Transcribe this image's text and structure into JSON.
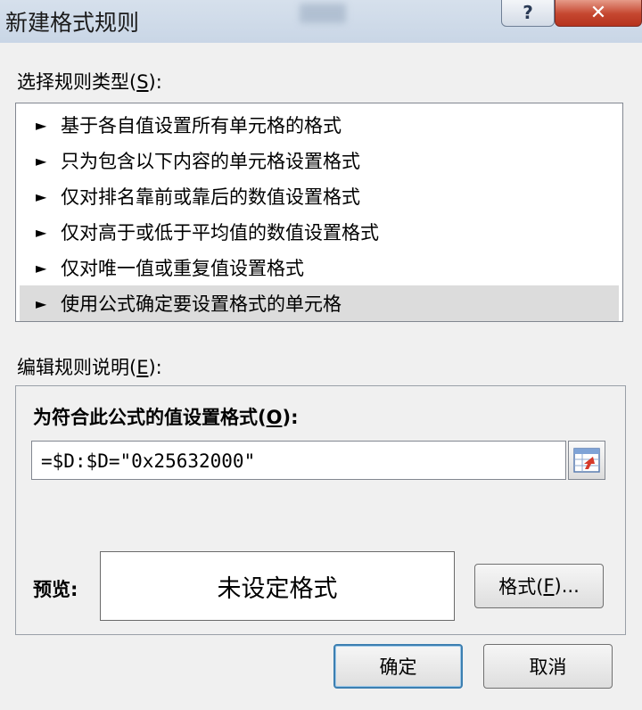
{
  "window": {
    "title": "新建格式规则",
    "help_label": "?",
    "close_label": "✕"
  },
  "rule_type": {
    "label_prefix": "选择规则类型(",
    "label_key": "S",
    "label_suffix": "):",
    "items": [
      {
        "label": "基于各自值设置所有单元格的格式",
        "selected": false
      },
      {
        "label": "只为包含以下内容的单元格设置格式",
        "selected": false
      },
      {
        "label": "仅对排名靠前或靠后的数值设置格式",
        "selected": false
      },
      {
        "label": "仅对高于或低于平均值的数值设置格式",
        "selected": false
      },
      {
        "label": "仅对唯一值或重复值设置格式",
        "selected": false
      },
      {
        "label": "使用公式确定要设置格式的单元格",
        "selected": true
      }
    ],
    "item_arrow": "►"
  },
  "description": {
    "label_prefix": "编辑规则说明(",
    "label_key": "E",
    "label_suffix": "):",
    "formula_label_prefix": "为符合此公式的值设置格式(",
    "formula_label_key": "O",
    "formula_label_suffix": "):",
    "formula_value": "=$D:$D=\"0x25632000\"",
    "preview_label": "预览:",
    "preview_text": "未设定格式",
    "format_button_prefix": "格式(",
    "format_button_key": "F",
    "format_button_suffix": ")..."
  },
  "footer": {
    "ok_label": "确定",
    "cancel_label": "取消"
  },
  "icons": {
    "collapse_dialog": "range-select-icon"
  }
}
